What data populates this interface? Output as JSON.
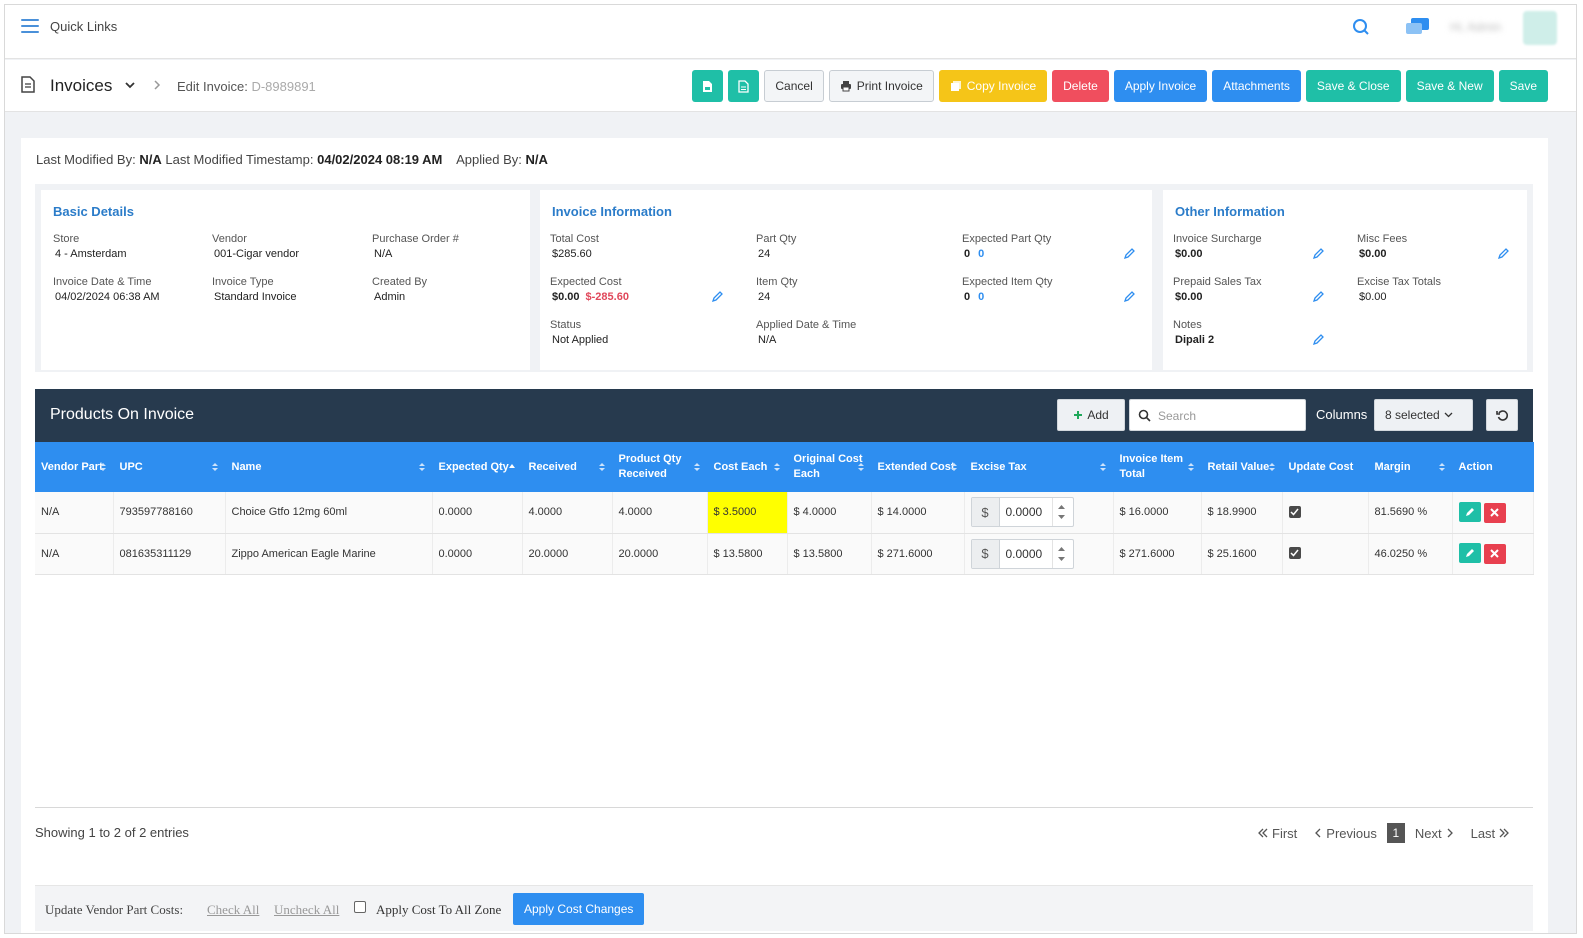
{
  "topbar": {
    "quick_links": "Quick Links",
    "user_name": "Hi, Admin"
  },
  "header": {
    "title": "Invoices",
    "breadcrumb_label": "Edit Invoice:",
    "breadcrumb_id": "D-8989891",
    "buttons": {
      "cancel": "Cancel",
      "print": "Print Invoice",
      "copy": "Copy Invoice",
      "delete": "Delete",
      "apply": "Apply Invoice",
      "attachments": "Attachments",
      "save_close": "Save & Close",
      "save_new": "Save & New",
      "save": "Save"
    }
  },
  "meta": {
    "modified_by_label": "Last Modified By:",
    "modified_by": "N/A",
    "timestamp_label": "Last Modified Timestamp:",
    "timestamp": "04/02/2024 08:19 AM",
    "applied_by_label": "Applied By:",
    "applied_by": "N/A"
  },
  "basic": {
    "title": "Basic Details",
    "store_label": "Store",
    "store": "4 - Amsterdam",
    "vendor_label": "Vendor",
    "vendor": "001-Cigar vendor",
    "po_label": "Purchase Order #",
    "po": "N/A",
    "date_label": "Invoice Date & Time",
    "date": "04/02/2024 06:38 AM",
    "type_label": "Invoice Type",
    "type": "Standard Invoice",
    "created_label": "Created By",
    "created": "Admin"
  },
  "info": {
    "title": "Invoice Information",
    "total_cost_label": "Total Cost",
    "total_cost": "$285.60",
    "part_qty_label": "Part Qty",
    "part_qty": "24",
    "exp_part_qty_label": "Expected Part Qty",
    "exp_part_qty": "0",
    "exp_part_qty_diff": "0",
    "exp_cost_label": "Expected Cost",
    "exp_cost": "$0.00",
    "exp_cost_diff": "$-285.60",
    "item_qty_label": "Item Qty",
    "item_qty": "24",
    "exp_item_qty_label": "Expected Item Qty",
    "exp_item_qty": "0",
    "exp_item_qty_diff": "0",
    "status_label": "Status",
    "status": "Not Applied",
    "applied_date_label": "Applied Date & Time",
    "applied_date": "N/A"
  },
  "other": {
    "title": "Other Information",
    "surcharge_label": "Invoice Surcharge",
    "surcharge": "$0.00",
    "misc_label": "Misc Fees",
    "misc": "$0.00",
    "prepaid_label": "Prepaid Sales Tax",
    "prepaid": "$0.00",
    "excise_label": "Excise Tax Totals",
    "excise": "$0.00",
    "notes_label": "Notes",
    "notes": "Dipali 2"
  },
  "products": {
    "title": "Products On Invoice",
    "add": "Add",
    "search_placeholder": "Search",
    "columns_label": "Columns",
    "columns_value": "8 selected",
    "headers": {
      "vendor_part": "Vendor Part",
      "upc": "UPC",
      "name": "Name",
      "expected_qty": "Expected Qty",
      "received": "Received",
      "product_qty_received": "Product Qty Received",
      "cost_each": "Cost Each",
      "original_cost_each": "Original Cost Each",
      "extended_cost": "Extended Cost",
      "excise_tax": "Excise Tax",
      "invoice_item_total": "Invoice Item Total",
      "retail_value": "Retail Value",
      "update_cost": "Update Cost",
      "margin": "Margin",
      "action": "Action"
    },
    "rows": [
      {
        "vendor_part": "N/A",
        "upc": "793597788160",
        "name": "Choice Gtfo 12mg 60ml",
        "expected_qty": "0.0000",
        "received": "4.0000",
        "product_qty_received": "4.0000",
        "cost_each": "$ 3.5000",
        "original_cost_each": "$ 4.0000",
        "extended_cost": "$ 14.0000",
        "excise_symbol": "$",
        "excise_tax": "0.0000",
        "invoice_item_total": "$ 16.0000",
        "retail_value": "$ 18.9900",
        "margin": "81.5690 %"
      },
      {
        "vendor_part": "N/A",
        "upc": "081635311129",
        "name": "Zippo American Eagle Marine",
        "expected_qty": "0.0000",
        "received": "20.0000",
        "product_qty_received": "20.0000",
        "cost_each": "$ 13.5800",
        "original_cost_each": "$ 13.5800",
        "extended_cost": "$ 271.6000",
        "excise_symbol": "$",
        "excise_tax": "0.0000",
        "invoice_item_total": "$ 271.6000",
        "retail_value": "$ 25.1600",
        "margin": "46.0250 %"
      }
    ],
    "showing": "Showing 1 to 2 of 2 entries",
    "pager": {
      "first": "First",
      "previous": "Previous",
      "page": "1",
      "next": "Next",
      "last": "Last"
    }
  },
  "bottom": {
    "label": "Update Vendor Part Costs:",
    "check_all": "Check All",
    "uncheck_all": "Uncheck All",
    "apply_all_zone": "Apply Cost To All Zone",
    "apply_changes": "Apply Cost Changes"
  },
  "colors": {
    "accent_blue": "#2e8ef0",
    "teal": "#1fbfa7",
    "header_dark": "#273a4e",
    "highlight": "#ffff00"
  }
}
